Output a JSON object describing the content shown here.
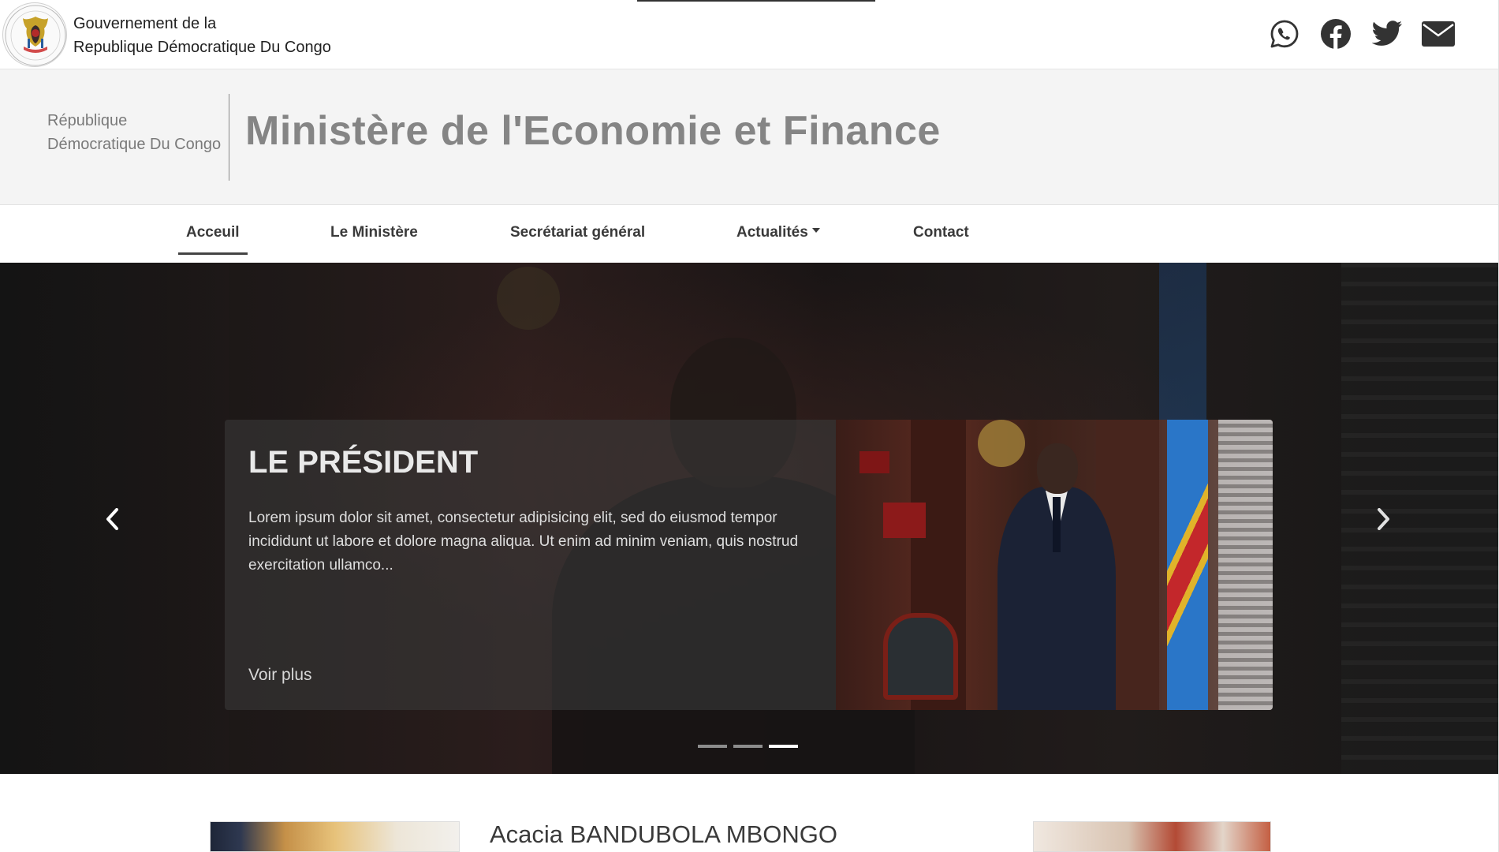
{
  "topbar": {
    "gov_line1": "Gouvernement de la",
    "gov_line2": "Republique Démocratique Du Congo",
    "social_icons": [
      "whatsapp-icon",
      "facebook-icon",
      "twitter-icon",
      "email-icon"
    ]
  },
  "header": {
    "country_line1": "République",
    "country_line2": "Démocratique Du Congo",
    "ministry_title": "Ministère de l'Economie et Finance"
  },
  "nav": {
    "items": [
      {
        "label": "Acceuil",
        "active": true
      },
      {
        "label": "Le Ministère",
        "active": false
      },
      {
        "label": "Secrétariat général",
        "active": false
      },
      {
        "label": "Actualités",
        "active": false,
        "dropdown": true
      },
      {
        "label": "Contact",
        "active": false
      }
    ]
  },
  "hero": {
    "title": "LE PRÉSIDENT",
    "description": "Lorem ipsum dolor sit amet, consectetur adipisicing elit, sed do eiusmod tempor incididunt ut labore et dolore magna aliqua. Ut enim ad minim veniam, quis nostrud exercitation ullamco...",
    "cta": "Voir plus",
    "slide_count": 3,
    "active_slide": 3
  },
  "below": {
    "person_name": "Acacia BANDUBOLA MBONGO"
  },
  "colors": {
    "nav_text": "#3a3a3a",
    "header_bg": "#f4f4f4",
    "title_gray": "#858585"
  }
}
